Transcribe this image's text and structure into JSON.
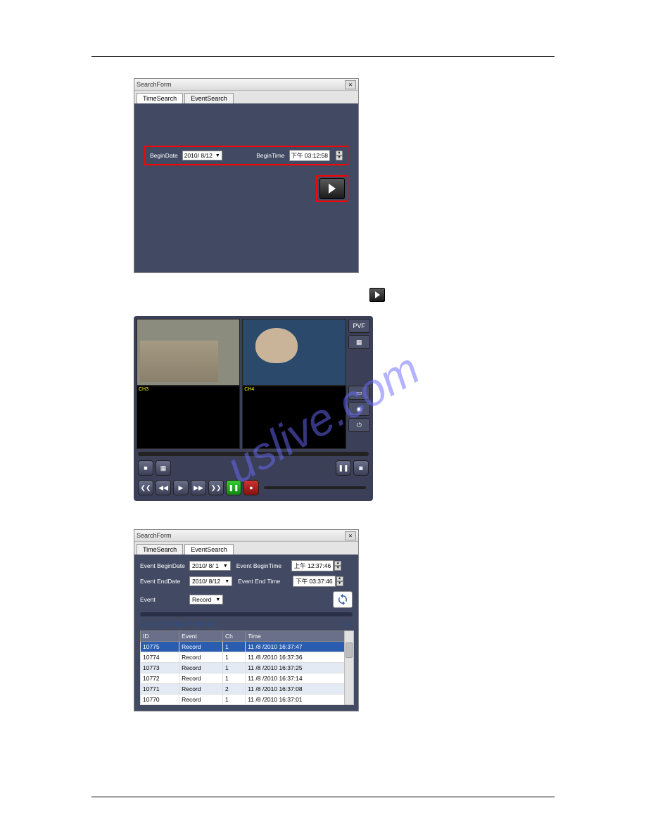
{
  "watermark": "uslive.com",
  "searchform": {
    "title": "SearchForm",
    "tabs": {
      "time": "TimeSearch",
      "event": "EventSearch"
    },
    "begindate_label": "BeginDate",
    "begindate_value": "2010/ 8/12",
    "begintime_label": "BeginTime",
    "begintime_value": "下午 03:12:58"
  },
  "player": {
    "ch1_overlay": "",
    "ch2_overlay": "",
    "ch3_label": "CH3",
    "ch4_label": "CH4",
    "side": {
      "pvf": "PVF"
    }
  },
  "eventsearch": {
    "title": "SearchForm",
    "tabs": {
      "time": "TimeSearch",
      "event": "EventSearch"
    },
    "ev_begindate_label": "Event BeginDate",
    "ev_begindate_value": "2010/ 8/ 1",
    "ev_begintime_label": "Event BeginTime",
    "ev_begintime_value": "上午 12:37:46",
    "ev_enddate_label": "Event EndDate",
    "ev_enddate_value": "2010/ 8/12",
    "ev_endtime_label": "Event End Time",
    "ev_endtime_value": "下午 03:37:46",
    "event_label": "Event",
    "event_value": "Record",
    "pager": {
      "first": "<<",
      "p1": "1",
      "p2": "2",
      "p3": "3",
      "p4": "4",
      "p5": "5",
      "p6": "6",
      "p7": "7",
      "p8": "8",
      "p9": "9",
      "p10": "10",
      "last": ">>"
    },
    "headers": {
      "id": "ID",
      "event": "Event",
      "ch": "Ch",
      "time": "Time"
    },
    "rows": [
      {
        "id": "10775",
        "event": "Record",
        "ch": "1",
        "time": "11 /8 /2010 16:37:47"
      },
      {
        "id": "10774",
        "event": "Record",
        "ch": "1",
        "time": "11 /8 /2010 16:37:36"
      },
      {
        "id": "10773",
        "event": "Record",
        "ch": "1",
        "time": "11 /8 /2010 16:37:25"
      },
      {
        "id": "10772",
        "event": "Record",
        "ch": "1",
        "time": "11 /8 /2010 16:37:14"
      },
      {
        "id": "10771",
        "event": "Record",
        "ch": "2",
        "time": "11 /8 /2010 16:37:08"
      },
      {
        "id": "10770",
        "event": "Record",
        "ch": "1",
        "time": "11 /8 /2010 16:37:01"
      }
    ]
  }
}
